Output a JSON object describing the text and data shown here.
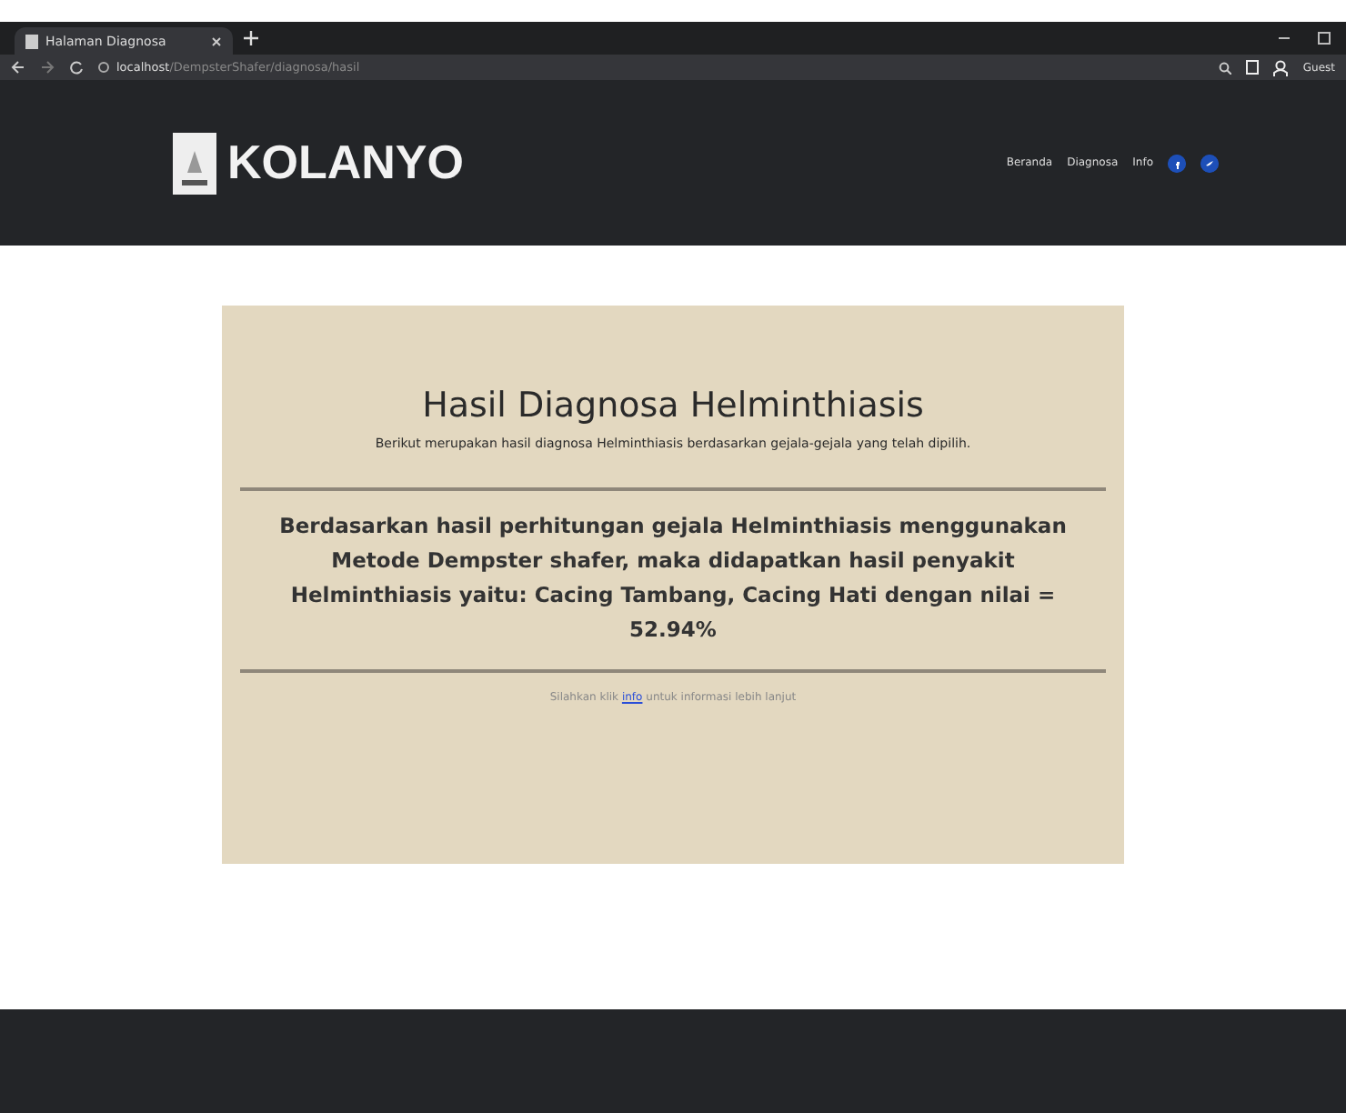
{
  "browser": {
    "tab_title": "Halaman Diagnosa",
    "url_host": "localhost",
    "url_path": "/DempsterShafer/diagnosa/hasil",
    "profile": "Guest"
  },
  "navbar": {
    "brand": "KOLANYO",
    "links": [
      "Beranda",
      "Diagnosa",
      "Info"
    ]
  },
  "card": {
    "title": "Hasil Diagnosa Helminthiasis",
    "subtitle": "Berikut merupakan hasil diagnosa Helminthiasis berdasarkan gejala-gejala yang telah dipilih.",
    "result": "Berdasarkan hasil perhitungan gejala Helminthiasis menggunakan Metode Dempster shafer, maka didapatkan hasil penyakit Helminthiasis yaitu: Cacing Tambang, Cacing Hati dengan nilai = 52.94%",
    "note_before": "Silahkan klik",
    "note_link": "info",
    "note_after": "untuk informasi lebih lanjut"
  }
}
